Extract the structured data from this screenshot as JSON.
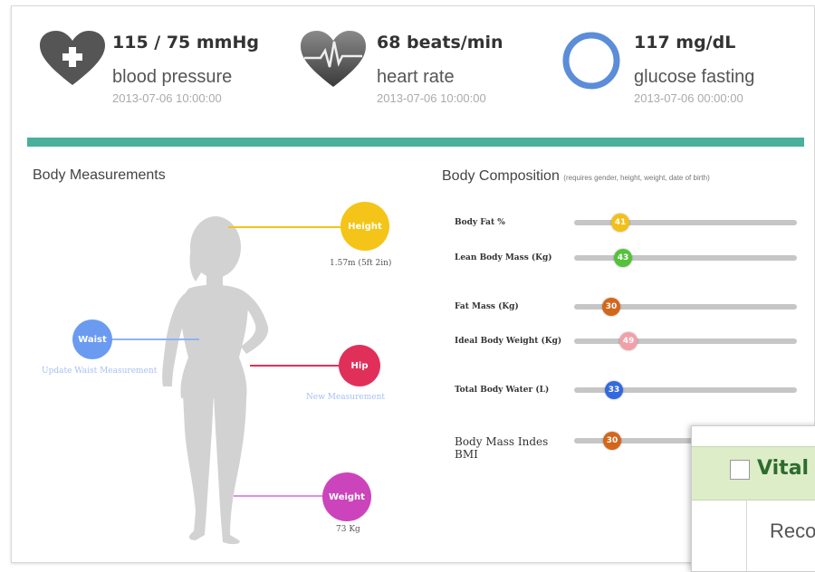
{
  "vitals": {
    "blood_pressure": {
      "value": "115 / 75 mmHg",
      "label": "blood pressure",
      "timestamp": "2013-07-06 10:00:00",
      "icon": "heart-plus-icon"
    },
    "heart_rate": {
      "value": "68 beats/min",
      "label": "heart rate",
      "timestamp": "2013-07-06 10:00:00",
      "icon": "heart-ecg-icon"
    },
    "glucose": {
      "value": "117 mg/dL",
      "label": "glucose fasting",
      "timestamp": "2013-07-06 00:00:00",
      "icon": "ring-icon"
    }
  },
  "colors": {
    "accent_teal": "#4aaf9b",
    "height": "#f4c518",
    "waist": "#6b9bf0",
    "hip": "#e0305a",
    "weight": "#cc44bb",
    "glucose_ring": "#5b8dd9"
  },
  "body_measurements": {
    "title": "Body Measurements",
    "height": {
      "label": "Height",
      "caption": "1.57m (5ft 2in)"
    },
    "waist": {
      "label": "Waist",
      "caption": "Update Waist Measurement"
    },
    "hip": {
      "label": "Hip",
      "caption": "New Measurement"
    },
    "weight": {
      "label": "Weight",
      "caption": "73 Kg"
    }
  },
  "body_composition": {
    "title": "Body Composition",
    "note": "(requires gender, height, weight, date of birth)",
    "rows": [
      {
        "label": "Body Fat %",
        "value": "41",
        "color": "#f2c018"
      },
      {
        "label": "Lean Body Mass (Kg)",
        "value": "43",
        "color": "#55c23c"
      },
      {
        "label": "Fat Mass (Kg)",
        "value": "30",
        "color": "#d4661a"
      },
      {
        "label": "Ideal Body Weight (Kg)",
        "value": "49",
        "color": "#f2a0a8"
      },
      {
        "label": "Total Body Water (L)",
        "value": "33",
        "color": "#3468e0"
      },
      {
        "label": "Body Mass Indes BMI",
        "value": "30",
        "color": "#d4661a"
      }
    ]
  },
  "popup": {
    "title": "Vital s",
    "column": "Reco"
  }
}
